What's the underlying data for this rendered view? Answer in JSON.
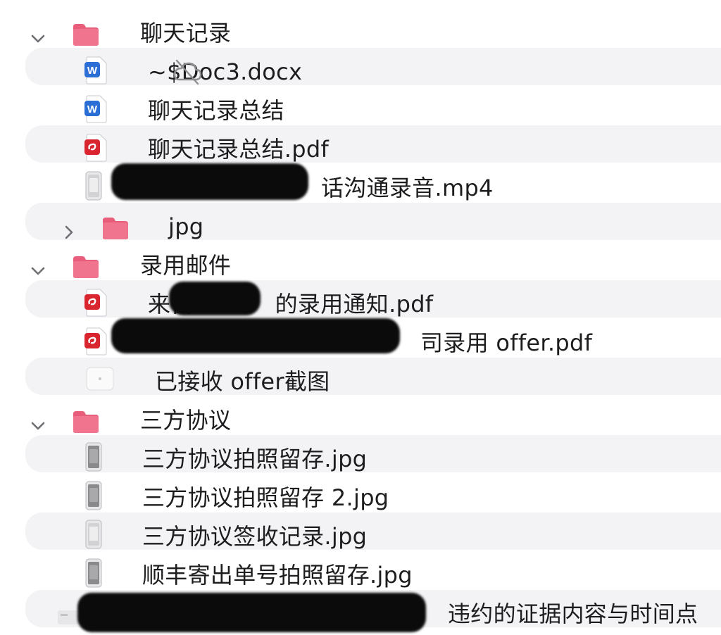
{
  "window": {
    "title": ""
  },
  "rows": [
    {
      "kind": "folder",
      "name": "聊天记录",
      "expanded": true,
      "level": 0
    },
    {
      "kind": "word",
      "name": "~$Doc3.docx",
      "level": 1,
      "icon": "word-doc-icon",
      "status_icon": "cloud-slash-icon"
    },
    {
      "kind": "word",
      "name": "聊天记录总结",
      "level": 1,
      "icon": "word-doc-icon"
    },
    {
      "kind": "pdf",
      "name": "聊天记录总结.pdf",
      "level": 1,
      "icon": "pdf-icon"
    },
    {
      "kind": "video",
      "name": "话沟通录音.mp4",
      "level": 1,
      "icon": "video-thumbnail-icon",
      "redacted_prefix": true
    },
    {
      "kind": "folder",
      "name": "jpg",
      "expanded": false,
      "level": 1
    },
    {
      "kind": "folder",
      "name": "录用邮件",
      "expanded": true,
      "level": 0
    },
    {
      "kind": "pdf",
      "name": "来自",
      "name_suffix": "的录用通知.pdf",
      "level": 1,
      "icon": "pdf-icon",
      "redacted_middle": true
    },
    {
      "kind": "pdf",
      "name": "司录用 offer.pdf",
      "level": 1,
      "icon": "pdf-icon",
      "redacted_prefix": true
    },
    {
      "kind": "image",
      "name": "已接收 offer截图",
      "level": 1,
      "icon": "image-thumbnail-icon"
    },
    {
      "kind": "folder",
      "name": "三方协议",
      "expanded": true,
      "level": 0
    },
    {
      "kind": "image",
      "name": "三方协议拍照留存.jpg",
      "level": 1,
      "icon": "photo-thumbnail-icon"
    },
    {
      "kind": "image",
      "name": "三方协议拍照留存 2.jpg",
      "level": 1,
      "icon": "photo-thumbnail-icon"
    },
    {
      "kind": "image",
      "name": "三方协议签收记录.jpg",
      "level": 1,
      "icon": "photo-thumbnail-icon"
    },
    {
      "kind": "image",
      "name": "顺丰寄出单号拍照留存.jpg",
      "level": 1,
      "icon": "photo-thumbnail-icon"
    },
    {
      "kind": "file",
      "name": "违约的证据内容与时间点",
      "level": 0,
      "icon": "file-icon",
      "redacted_prefix": true
    }
  ],
  "colors": {
    "folder": "#f0748e",
    "folder_tab": "#e85d7a",
    "word": "#2b6fd6",
    "pdf": "#d9252e",
    "stripe": "#f3f3f5",
    "chevron": "#6e6e73"
  }
}
